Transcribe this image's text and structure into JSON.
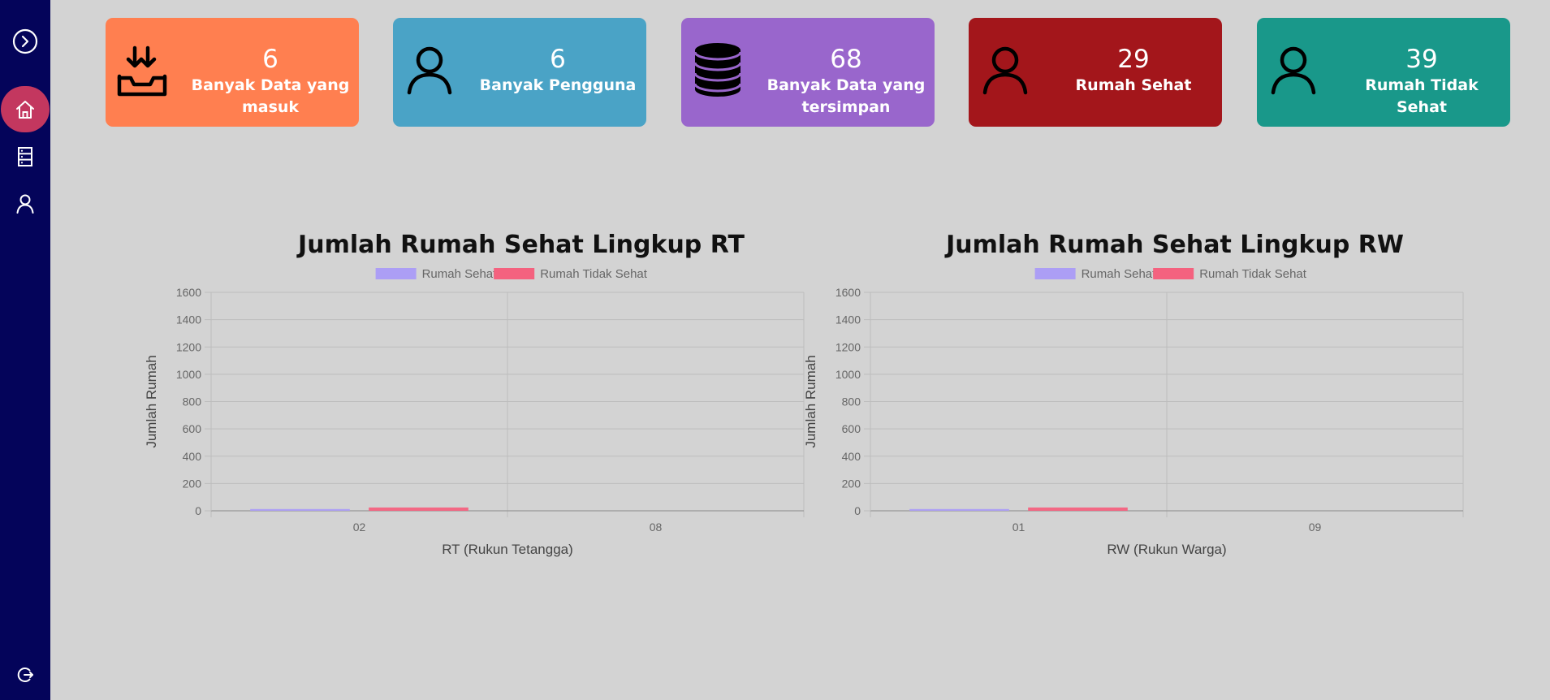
{
  "sidebar": {
    "items": [
      {
        "name": "expand-toggle",
        "icon": "chevron-right-circle-icon"
      },
      {
        "name": "home",
        "icon": "home-icon",
        "active": true
      },
      {
        "name": "data",
        "icon": "server-list-icon"
      },
      {
        "name": "users",
        "icon": "user-icon"
      }
    ],
    "logout_icon": "logout-icon",
    "colors": {
      "background": "#04045a",
      "active": "#c3375f"
    }
  },
  "stats": [
    {
      "value": "6",
      "label": "Banyak Data yang masuk",
      "color": "#ff7f50",
      "icon": "download-tray-icon"
    },
    {
      "value": "6",
      "label": "Banyak Pengguna",
      "color": "#4aa3c6",
      "icon": "user-icon"
    },
    {
      "value": "68",
      "label": "Banyak Data yang tersimpan",
      "color": "#9966cc",
      "icon": "database-icon"
    },
    {
      "value": "29",
      "label": "Rumah Sehat",
      "color": "#a3161b",
      "icon": "user-icon"
    },
    {
      "value": "39",
      "label": "Rumah Tidak Sehat",
      "color": "#19988a",
      "icon": "user-icon"
    }
  ],
  "charts": {
    "rt_title": "Jumlah Rumah Sehat Lingkup RT",
    "rw_title": "Jumlah Rumah Sehat Lingkup RW"
  },
  "chart_data": [
    {
      "type": "bar",
      "title": "Jumlah Rumah Sehat Lingkup RT",
      "categories": [
        "02",
        "08"
      ],
      "series": [
        {
          "name": "Rumah Sehat",
          "values": [
            13,
            0
          ],
          "color": "#ac9ef5"
        },
        {
          "name": "Rumah Tidak Sehat",
          "values": [
            24,
            0
          ],
          "color": "#f4627f"
        }
      ],
      "xlabel": "RT (Rukun Tetangga)",
      "ylabel": "Jumlah Rumah",
      "ylim": [
        0,
        1600
      ],
      "yticks": [
        0,
        200,
        400,
        600,
        800,
        1000,
        1200,
        1400,
        1600
      ],
      "grid": true,
      "legend": "top"
    },
    {
      "type": "bar",
      "title": "Jumlah Rumah Sehat Lingkup RW",
      "categories": [
        "01",
        "09"
      ],
      "series": [
        {
          "name": "Rumah Sehat",
          "values": [
            13,
            0
          ],
          "color": "#ac9ef5"
        },
        {
          "name": "Rumah Tidak Sehat",
          "values": [
            24,
            0
          ],
          "color": "#f4627f"
        }
      ],
      "xlabel": "RW (Rukun Warga)",
      "ylabel": "Jumlah Rumah",
      "ylim": [
        0,
        1600
      ],
      "yticks": [
        0,
        200,
        400,
        600,
        800,
        1000,
        1200,
        1400,
        1600
      ],
      "grid": true,
      "legend": "top"
    }
  ]
}
